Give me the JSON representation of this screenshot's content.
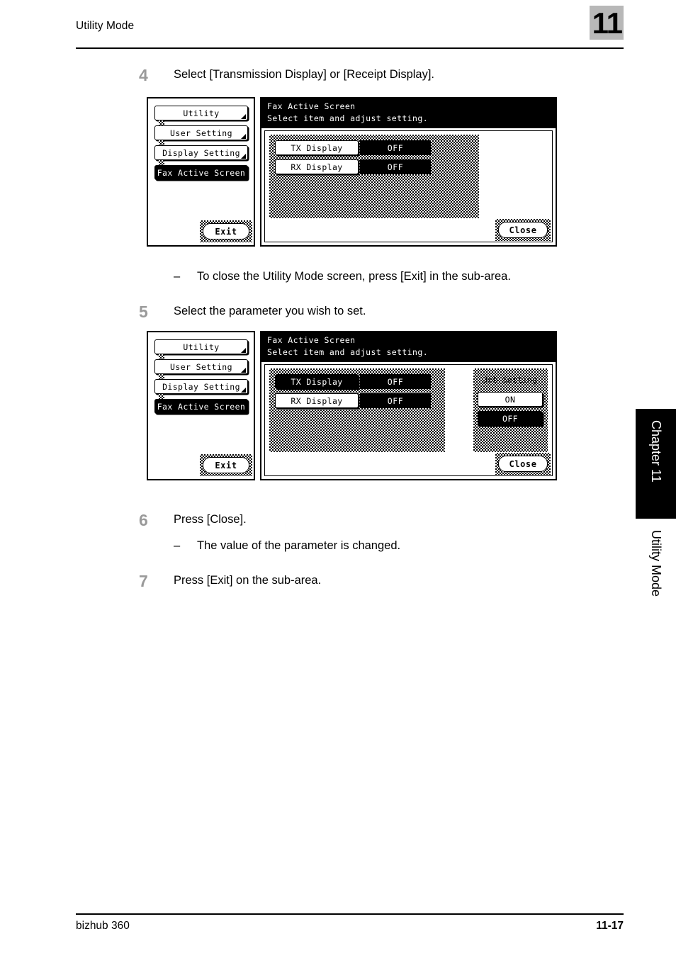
{
  "header": {
    "title": "Utility Mode",
    "chapter_number": "11"
  },
  "footer": {
    "product": "bizhub 360",
    "page_number": "11-17"
  },
  "side_tabs": {
    "chapter": "Chapter 11",
    "section": "Utility Mode"
  },
  "steps": [
    {
      "number": "4",
      "text": "Select [Transmission Display] or [Receipt Display]."
    },
    {
      "number": "5",
      "text": "Select the parameter you wish to set."
    },
    {
      "number": "6",
      "text": "Press [Close]."
    },
    {
      "number": "7",
      "text": "Press [Exit] on the sub-area."
    }
  ],
  "notes": [
    {
      "dash": "–",
      "text": "To close the Utility Mode screen, press [Exit] in the sub-area."
    },
    {
      "dash": "–",
      "text": "The value of the parameter is changed."
    }
  ],
  "screens": [
    {
      "sidebar": {
        "crumbs": [
          {
            "label": "Utility"
          },
          {
            "label": "User Setting"
          },
          {
            "label": "Display Setting"
          },
          {
            "label": "Fax Active Screen"
          }
        ],
        "exit_label": "Exit"
      },
      "title": "Fax Active Screen",
      "subtitle": "Select item and adjust setting.",
      "rows": [
        {
          "label": "TX Display",
          "value": "OFF"
        },
        {
          "label": "RX Display",
          "value": "OFF"
        }
      ],
      "close_label": "Close"
    },
    {
      "sidebar": {
        "crumbs": [
          {
            "label": "Utility"
          },
          {
            "label": "User Setting"
          },
          {
            "label": "Display Setting"
          },
          {
            "label": "Fax Active Screen"
          }
        ],
        "exit_label": "Exit"
      },
      "title": "Fax Active Screen",
      "subtitle": "Select item and adjust setting.",
      "rows": [
        {
          "label": "TX Display",
          "value": "OFF"
        },
        {
          "label": "RX Display",
          "value": "OFF"
        }
      ],
      "job_panel": {
        "label": "Job Setting",
        "options": [
          {
            "label": "ON"
          },
          {
            "label": "OFF"
          }
        ]
      },
      "close_label": "Close"
    }
  ]
}
